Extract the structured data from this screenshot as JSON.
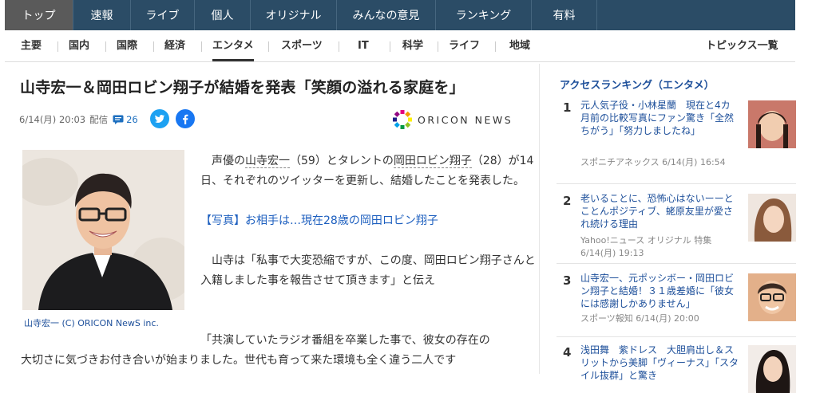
{
  "top_nav": [
    "トップ",
    "速報",
    "ライブ",
    "個人",
    "オリジナル",
    "みんなの意見",
    "ランキング",
    "有料"
  ],
  "sub_nav": [
    "主要",
    "国内",
    "国際",
    "経済",
    "エンタメ",
    "スポーツ",
    "IT",
    "科学",
    "ライフ",
    "地域"
  ],
  "topics_link": "トピックス一覧",
  "article": {
    "title": "山寺宏一＆岡田ロビン翔子が結婚を発表「笑顔の溢れる家庭を」",
    "date": "6/14(月) 20:03",
    "date_suffix": "配信",
    "comment_count": "26",
    "source_logo": "ORICON NEWS",
    "photo_caption": "山寺宏一 (C) ORICON NewS inc.",
    "p1_a": "声優の",
    "p1_name1": "山寺宏一",
    "p1_b": "（59）とタレントの",
    "p1_name2": "岡田ロビン翔子",
    "p1_c": "（28）が14日、それぞれのツイッターを更新し、結婚したことを発表した。",
    "photo_link": "【写真】お相手は…現在28歳の岡田ロビン翔子",
    "p3_a": "山寺は「私事で大変恐縮ですが、この度、岡田ロビン翔子さんと入籍しました事を報告させて頂きます」と伝え",
    "p3_line3": "「共演していたラジオ番組を卒業した事で、彼女の存在の",
    "p3_line4": "大切さに気づきお付き合いが始まりました。世代も育って来た環境も全く違う二人です"
  },
  "ranking": {
    "title": "アクセスランキング（エンタメ）",
    "items": [
      {
        "rank": "1",
        "title": "元人気子役・小林星蘭　現在と4カ月前の比較写真にファン驚き「全然ちがう」「努力しましたね」",
        "source": "スポニチアネックス 6/14(月) 16:54"
      },
      {
        "rank": "2",
        "title": "老いることに、恐怖心はないーーとことんポジティブ、蛯原友里が愛され続ける理由",
        "source": "Yahoo!ニュース オリジナル 特集 6/14(月) 19:13"
      },
      {
        "rank": "3",
        "title": "山寺宏一、元ポッシボー・岡田ロビン翔子と結婚！３１歳差婚に「彼女には感謝しかありません」",
        "source": "スポーツ報知 6/14(月) 20:00"
      },
      {
        "rank": "4",
        "title": "浅田舞　紫ドレス　大胆肩出し＆スリットから美脚「ヴィーナス」「スタイル抜群」と驚き",
        "source": ""
      }
    ]
  },
  "colors": {
    "nav_bg": "#2b4c66",
    "nav_active": "#5a5a5a",
    "link": "#1d4f9a",
    "twitter": "#1da1f2",
    "facebook": "#1877f2"
  }
}
